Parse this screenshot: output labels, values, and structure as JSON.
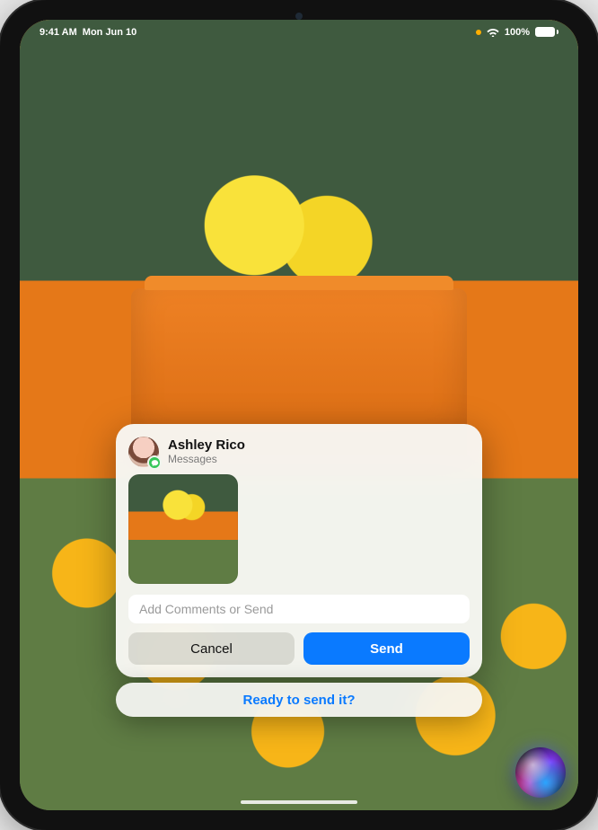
{
  "status_bar": {
    "time": "9:41 AM",
    "date": "Mon Jun 10",
    "battery_percent": "100%"
  },
  "share_card": {
    "contact_name": "Ashley Rico",
    "app_name": "Messages",
    "input_placeholder": "Add Comments or Send",
    "cancel_label": "Cancel",
    "send_label": "Send"
  },
  "siri": {
    "prompt": "Ready to send it?"
  }
}
